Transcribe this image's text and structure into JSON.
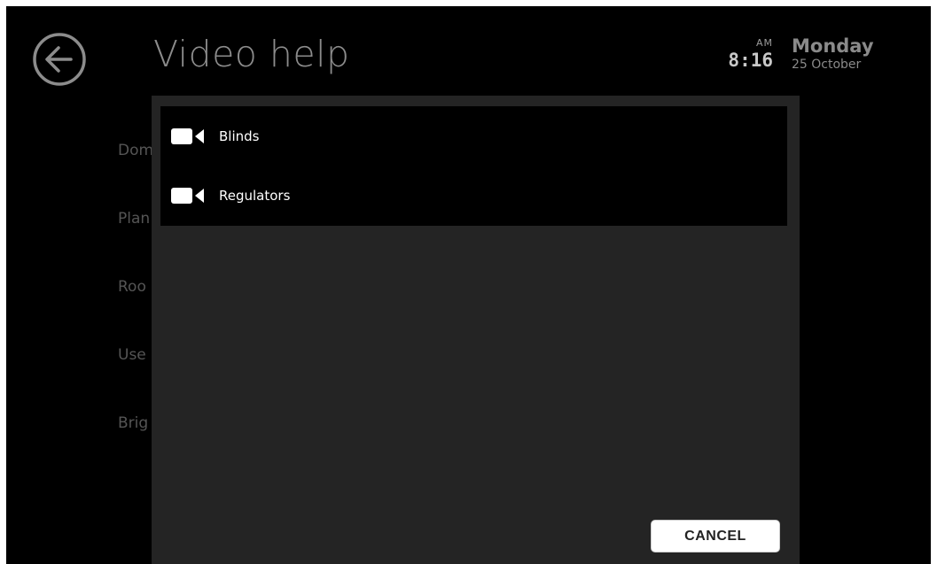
{
  "header": {
    "title": "Video help",
    "back_icon": "back-arrow-circle-icon"
  },
  "clock": {
    "ampm": "AM",
    "time": "8:16"
  },
  "date": {
    "weekday": "Monday",
    "day_month": "25 October"
  },
  "background_menu": {
    "items": [
      {
        "label": "Dom"
      },
      {
        "label": "Plan"
      },
      {
        "label": "Roo"
      },
      {
        "label": "Use"
      },
      {
        "label": "Brig"
      }
    ]
  },
  "dialog": {
    "videos": [
      {
        "label": "Blinds",
        "icon": "video-camera-icon"
      },
      {
        "label": "Regulators",
        "icon": "video-camera-icon"
      }
    ],
    "cancel_label": "CANCEL"
  },
  "colors": {
    "background": "#000000",
    "dialog_background": "#242424",
    "list_background": "#000000",
    "title": "#8c8c8c",
    "accent_white": "#ffffff"
  }
}
